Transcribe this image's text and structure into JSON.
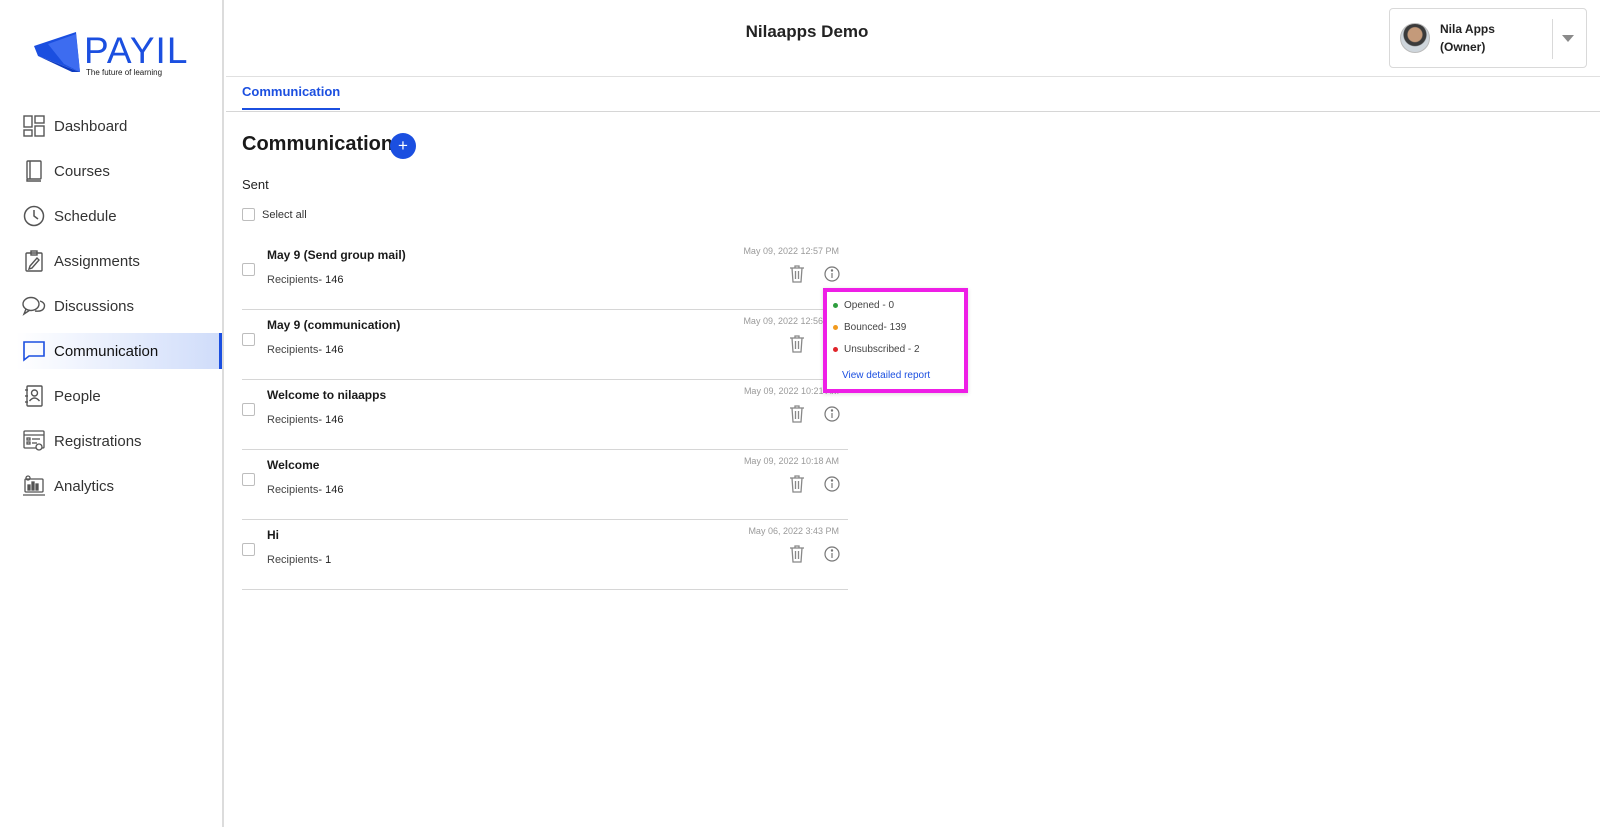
{
  "logo": {
    "text": "PAYIL",
    "tagline": "The future of learning"
  },
  "sidebar": {
    "items": [
      {
        "label": "Dashboard",
        "icon": "dashboard-icon"
      },
      {
        "label": "Courses",
        "icon": "book-icon"
      },
      {
        "label": "Schedule",
        "icon": "clock-icon"
      },
      {
        "label": "Assignments",
        "icon": "clipboard-icon"
      },
      {
        "label": "Discussions",
        "icon": "chat-bubbles-icon"
      },
      {
        "label": "Communication",
        "icon": "message-icon",
        "active": true
      },
      {
        "label": "People",
        "icon": "contact-book-icon"
      },
      {
        "label": "Registrations",
        "icon": "registration-form-icon"
      },
      {
        "label": "Analytics",
        "icon": "analytics-icon"
      }
    ]
  },
  "header": {
    "title": "Nilaapps Demo",
    "user": {
      "name": "Nila Apps",
      "role": "(Owner)"
    }
  },
  "tabs": [
    {
      "label": "Communication",
      "active": true
    }
  ],
  "main": {
    "title": "Communication",
    "add_label": "+",
    "section": "Sent",
    "select_all": "Select all",
    "messages": [
      {
        "subject": "May 9 (Send group mail)",
        "recipients_label": "Recipients",
        "recipients": "- 146",
        "date": "May 09, 2022 12:57 PM"
      },
      {
        "subject": "May 9 (communication)",
        "recipients_label": "Recipients",
        "recipients": "- 146",
        "date": "May 09, 2022 12:56 PM"
      },
      {
        "subject": "Welcome to nilaapps",
        "recipients_label": "Recipients",
        "recipients": "- 146",
        "date": "May 09, 2022 10:21 AM"
      },
      {
        "subject": "Welcome",
        "recipients_label": "Recipients",
        "recipients": "- 146",
        "date": "May 09, 2022 10:18 AM"
      },
      {
        "subject": "Hi",
        "recipients_label": "Recipients",
        "recipients": "- 1",
        "date": "May 06, 2022 3:43 PM"
      }
    ]
  },
  "popover": {
    "opened": "Opened - 0",
    "bounced": "Bounced- 139",
    "unsubscribed": "Unsubscribed - 2",
    "link": "View detailed report",
    "colors": {
      "opened": "#2e9e3e",
      "bounced": "#f29a1d",
      "unsubscribed": "#e0242a",
      "highlight": "#ee1ee6"
    }
  },
  "colors": {
    "accent": "#1b4fe0"
  }
}
